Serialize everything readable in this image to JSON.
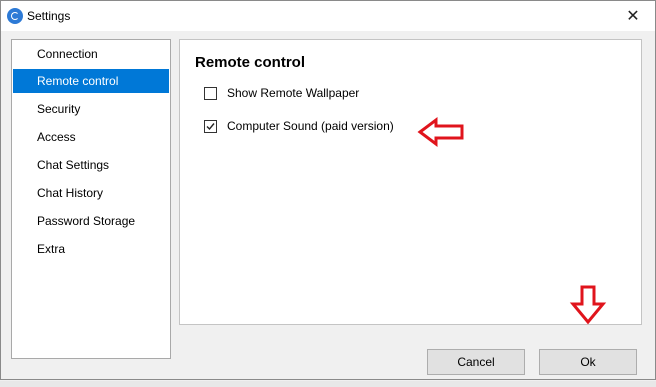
{
  "window": {
    "title": "Settings",
    "app_icon": "teamviewer-like-icon",
    "close_glyph": "✕"
  },
  "sidebar": {
    "selected": "Remote control",
    "items": [
      {
        "label": "Connection"
      },
      {
        "label": "Remote control"
      },
      {
        "label": "Security"
      },
      {
        "label": "Access"
      },
      {
        "label": "Chat Settings"
      },
      {
        "label": "Chat History"
      },
      {
        "label": "Password Storage"
      },
      {
        "label": "Extra"
      }
    ]
  },
  "main": {
    "section_title": "Remote control",
    "options": [
      {
        "label": "Show Remote Wallpaper",
        "checked": false
      },
      {
        "label": "Computer Sound (paid version)",
        "checked": true
      }
    ]
  },
  "annotations": {
    "arrow_color": "#e0141c",
    "arrow_left_icon": "red-left-arrow",
    "arrow_down_icon": "red-down-arrow"
  },
  "footer": {
    "cancel_label": "Cancel",
    "ok_label": "Ok"
  },
  "colors": {
    "selection": "#0078d7",
    "background": "#f0f0f0"
  }
}
